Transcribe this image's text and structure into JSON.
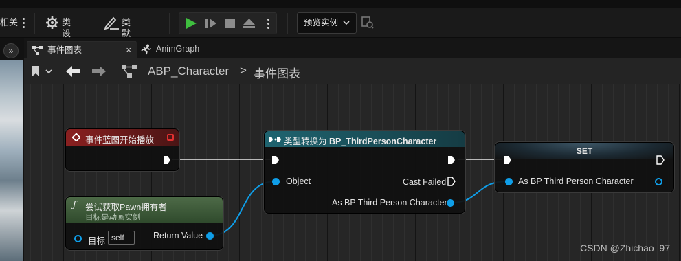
{
  "toolbar": {
    "cut_label": "相关",
    "class_settings": "类设置",
    "class_defaults": "类默认值",
    "preview_instance": "预览实例"
  },
  "tabs": [
    {
      "label": "事件图表",
      "close": "×"
    },
    {
      "label": "AnimGraph"
    }
  ],
  "breadcrumb": {
    "asset": "ABP_Character",
    "separator": ">",
    "graph": "事件图表"
  },
  "left_strip": {
    "collapse_glyph": "»"
  },
  "nodes": {
    "event_begin_play": {
      "title": "事件蓝图开始播放",
      "color": "#7a1e1e"
    },
    "try_get_pawn_owner": {
      "title": "尝试获取Pawn拥有者",
      "subtitle": "目标是动画实例",
      "target_label": "目标",
      "target_value": "self",
      "return_label": "Return Value",
      "color": "#3e5a3a"
    },
    "cast": {
      "title_prefix": "类型转换为",
      "title_class": "BP_ThirdPersonCharacter",
      "object_label": "Object",
      "cast_failed_label": "Cast Failed",
      "as_label": "As BP Third Person Character",
      "color": "#1e5a62"
    },
    "set": {
      "title": "SET",
      "var_label": "As BP Third Person Character"
    }
  },
  "watermark": "CSDN @Zhichao_97",
  "colors": {
    "data_pin": "#0f9ee8",
    "exec_pin": "#ffffff",
    "play_icon": "#3fbf3f"
  }
}
